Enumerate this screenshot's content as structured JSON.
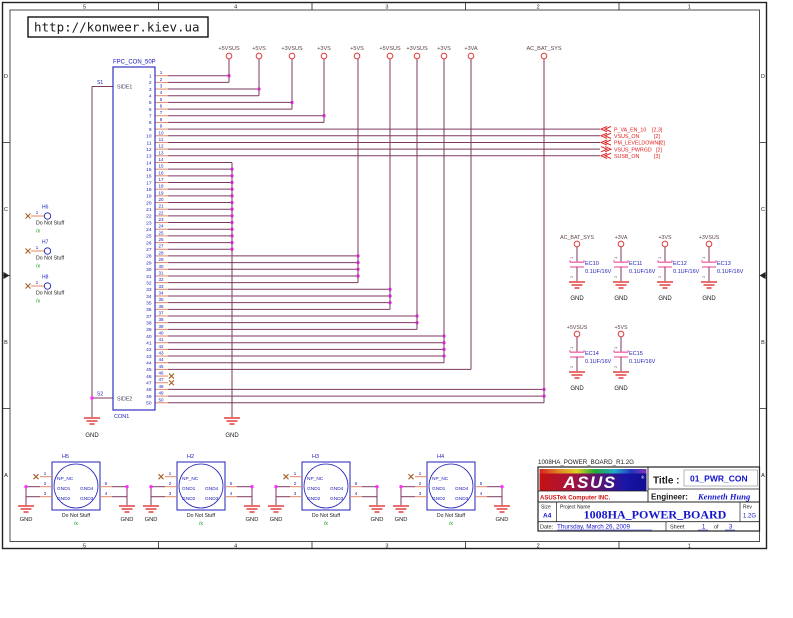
{
  "banner": {
    "url": "http://konweer.kiev.ua"
  },
  "frame": {
    "cols": [
      "5",
      "4",
      "3",
      "2",
      "1"
    ],
    "rows": [
      "D",
      "C",
      "B",
      "A"
    ]
  },
  "gnd_label": "GND",
  "connector": {
    "ref": "FPC_CON_50P",
    "side1": "SIDE1",
    "side2": "SIDE2",
    "footer": "CON1",
    "s1": "S1",
    "s2": "S2",
    "pins": [
      "1",
      "2",
      "3",
      "4",
      "5",
      "6",
      "7",
      "8",
      "9",
      "10",
      "11",
      "12",
      "13",
      "14",
      "15",
      "16",
      "17",
      "18",
      "19",
      "20",
      "21",
      "22",
      "23",
      "24",
      "25",
      "26",
      "27",
      "28",
      "29",
      "30",
      "31",
      "32",
      "33",
      "34",
      "35",
      "36",
      "37",
      "38",
      "39",
      "40",
      "41",
      "42",
      "43",
      "44",
      "45",
      "46",
      "47",
      "48",
      "49",
      "50"
    ]
  },
  "power_rails": [
    {
      "label": "+5VSUS"
    },
    {
      "label": "+5VS"
    },
    {
      "label": "+3VSUS"
    },
    {
      "label": "+3VS"
    },
    {
      "label": "+5VS"
    },
    {
      "label": "+5VSUS"
    },
    {
      "label": "+3VSUS"
    },
    {
      "label": "+3VS"
    },
    {
      "label": "+3VA"
    },
    {
      "label": "AC_BAT_SYS"
    }
  ],
  "signals": [
    {
      "name": "P_VA_EN_10",
      "pages": "[2,3]"
    },
    {
      "name": "VSUS_ON",
      "pages": "[2]"
    },
    {
      "name": "PM_LEVELDOWN#",
      "pages": "[2]"
    },
    {
      "name": "VSUS_PWRGD",
      "pages": "[2]"
    },
    {
      "name": "SUSB_ON",
      "pages": "[3]"
    }
  ],
  "capacitors_row1": [
    {
      "ref": "EC10",
      "value": "0.1UF/16V",
      "net": "AC_BAT_SYS",
      "pin1": "1",
      "pin2": "2"
    },
    {
      "ref": "EC11",
      "value": "0.1UF/16V",
      "net": "+3VA",
      "pin1": "1",
      "pin2": "2"
    },
    {
      "ref": "EC12",
      "value": "0.1UF/16V",
      "net": "+3VS",
      "pin1": "1",
      "pin2": "2"
    },
    {
      "ref": "EC13",
      "value": "0.1UF/16V",
      "net": "+3VSUS",
      "pin1": "1",
      "pin2": "2"
    }
  ],
  "capacitors_row2": [
    {
      "ref": "EC14",
      "value": "0.1UF/16V",
      "net": "+5VSUS",
      "pin1": "1",
      "pin2": "2"
    },
    {
      "ref": "EC15",
      "value": "0.1UF/16V",
      "net": "+5VS",
      "pin1": "1",
      "pin2": "2"
    }
  ],
  "mount_holes_small": [
    {
      "ref": "H6",
      "pin1": "1",
      "note": "Do Not Stuff",
      "mark": "/x"
    },
    {
      "ref": "H7",
      "pin1": "1",
      "note": "Do Not Stuff",
      "mark": "/x"
    },
    {
      "ref": "H8",
      "pin1": "1",
      "note": "Do Not Stuff",
      "mark": "/x"
    }
  ],
  "mount_holes_large": [
    {
      "ref": "H5",
      "pin1": "1",
      "pin2": "2",
      "pin3": "3",
      "pin4": "4",
      "pin5": "5",
      "net_nc": "NP_NC",
      "net_gnd1": "GND1",
      "net_gnd2": "GND2",
      "net_gnd3": "GND3",
      "net_gnd4": "GND4",
      "note": "Do Not Stuff",
      "mark": "/x"
    },
    {
      "ref": "H2",
      "pin1": "1",
      "pin2": "2",
      "pin3": "3",
      "pin4": "4",
      "pin5": "5",
      "net_nc": "NP_NC",
      "net_gnd1": "GND1",
      "net_gnd2": "GND2",
      "net_gnd3": "GND3",
      "net_gnd4": "GND4",
      "note": "Do Not Stuff",
      "mark": "/x"
    },
    {
      "ref": "H3",
      "pin1": "1",
      "pin2": "2",
      "pin3": "3",
      "pin4": "4",
      "pin5": "5",
      "net_nc": "NP_NC",
      "net_gnd1": "GND1",
      "net_gnd2": "GND2",
      "net_gnd3": "GND3",
      "net_gnd4": "GND4",
      "note": "Do Not Stuff",
      "mark": "/x"
    },
    {
      "ref": "H4",
      "pin1": "1",
      "pin2": "2",
      "pin3": "3",
      "pin4": "4",
      "pin5": "5",
      "net_nc": "NP_NC",
      "net_gnd1": "GND1",
      "net_gnd2": "GND2",
      "net_gnd3": "GND3",
      "net_gnd4": "GND4",
      "note": "Do Not Stuff",
      "mark": "/x"
    }
  ],
  "title_block": {
    "doc_name": "1008HA_POWER_BOARD_R1.2G",
    "logo_text": "ASUS",
    "logo_reg": "®",
    "company": "ASUSTek Computer INC.",
    "title_label": "Title :",
    "title_value": "01_PWR_CON",
    "engineer_label": "Engineer:",
    "engineer_value": "Kenneth Hung",
    "size_label": "Size",
    "size_value": "A4",
    "project_label": "Project Name",
    "project_value": "1008HA_POWER_BOARD",
    "rev_label": "Rev",
    "rev_value": "1.2G",
    "date_label": "Date:",
    "date_value": "Thursday, March 26, 2009",
    "sheet_label": "Sheet",
    "sheet_num": "1",
    "of_label": "of",
    "sheet_total": "3"
  },
  "colors": {
    "component_blue": "#2020bb",
    "wire_maroon": "#7d3a60",
    "net_red": "#e02020",
    "logo_red": "#cc1111",
    "value_blue": "#1515cc"
  }
}
